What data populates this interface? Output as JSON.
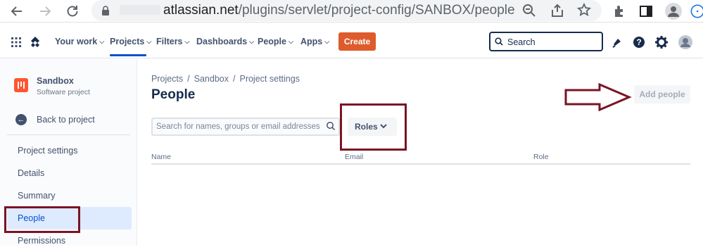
{
  "browser": {
    "url_host": "atlassian.net",
    "url_path": "/plugins/servlet/project-config/SANBOX/people"
  },
  "topnav": {
    "items": [
      {
        "label": "Your work"
      },
      {
        "label": "Projects"
      },
      {
        "label": "Filters"
      },
      {
        "label": "Dashboards"
      },
      {
        "label": "People"
      },
      {
        "label": "Apps"
      }
    ],
    "create_label": "Create",
    "search_placeholder": "Search"
  },
  "sidebar": {
    "project_name": "Sandbox",
    "project_type": "Software project",
    "back_label": "Back to project",
    "section_heading": "Project settings",
    "items": [
      {
        "label": "Details"
      },
      {
        "label": "Summary"
      },
      {
        "label": "People"
      },
      {
        "label": "Permissions"
      }
    ]
  },
  "main": {
    "breadcrumb": [
      "Projects",
      "Sandbox",
      "Project settings"
    ],
    "title": "People",
    "add_people_label": "Add people",
    "search_placeholder": "Search for names, groups or email addresses",
    "roles_label": "Roles",
    "columns": [
      "Name",
      "Email",
      "Role"
    ]
  },
  "colors": {
    "accent": "#0052cc",
    "create": "#de5b2c",
    "annotation": "#7a1424"
  }
}
